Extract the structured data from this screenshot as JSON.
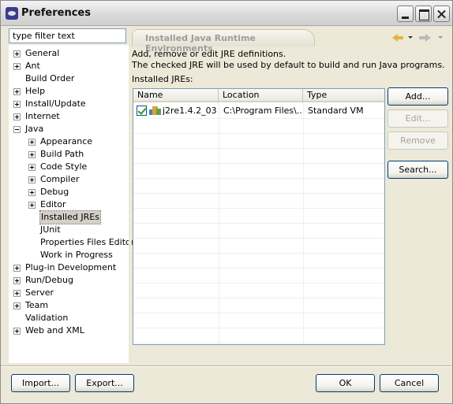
{
  "window": {
    "title": "Preferences"
  },
  "filter": {
    "placeholder": "type filter text"
  },
  "tree": [
    {
      "label": "General",
      "depth": 0,
      "expander": "plus"
    },
    {
      "label": "Ant",
      "depth": 0,
      "expander": "plus"
    },
    {
      "label": "Build Order",
      "depth": 0,
      "expander": "none"
    },
    {
      "label": "Help",
      "depth": 0,
      "expander": "plus"
    },
    {
      "label": "Install/Update",
      "depth": 0,
      "expander": "plus"
    },
    {
      "label": "Internet",
      "depth": 0,
      "expander": "plus"
    },
    {
      "label": "Java",
      "depth": 0,
      "expander": "minus"
    },
    {
      "label": "Appearance",
      "depth": 1,
      "expander": "plus"
    },
    {
      "label": "Build Path",
      "depth": 1,
      "expander": "plus"
    },
    {
      "label": "Code Style",
      "depth": 1,
      "expander": "plus"
    },
    {
      "label": "Compiler",
      "depth": 1,
      "expander": "plus"
    },
    {
      "label": "Debug",
      "depth": 1,
      "expander": "plus"
    },
    {
      "label": "Editor",
      "depth": 1,
      "expander": "plus"
    },
    {
      "label": "Installed JREs",
      "depth": 1,
      "expander": "none",
      "selected": true
    },
    {
      "label": "JUnit",
      "depth": 1,
      "expander": "none"
    },
    {
      "label": "Properties Files Editor",
      "depth": 1,
      "expander": "none"
    },
    {
      "label": "Work in Progress",
      "depth": 1,
      "expander": "none"
    },
    {
      "label": "Plug-in Development",
      "depth": 0,
      "expander": "plus"
    },
    {
      "label": "Run/Debug",
      "depth": 0,
      "expander": "plus"
    },
    {
      "label": "Server",
      "depth": 0,
      "expander": "plus"
    },
    {
      "label": "Team",
      "depth": 0,
      "expander": "plus"
    },
    {
      "label": "Validation",
      "depth": 0,
      "expander": "none"
    },
    {
      "label": "Web and XML",
      "depth": 0,
      "expander": "plus"
    }
  ],
  "page": {
    "title": "Installed Java Runtime Environments",
    "description_line1": "Add, remove or edit JRE definitions.",
    "description_line2": "The checked JRE will be used by default to build and run Java programs.",
    "installed_label": "Installed JREs:"
  },
  "table": {
    "columns": [
      "Name",
      "Location",
      "Type"
    ],
    "rows": [
      {
        "checked": true,
        "name": "j2re1.4.2_03",
        "location": "C:\\Program Files\\...",
        "type": "Standard VM"
      }
    ]
  },
  "side_buttons": {
    "add": "Add...",
    "edit": "Edit...",
    "remove": "Remove",
    "search": "Search..."
  },
  "footer": {
    "import": "Import...",
    "export": "Export...",
    "ok": "OK",
    "cancel": "Cancel"
  },
  "colors": {
    "dialog_bg": "#ECE9D8",
    "input_border": "#7f9db9",
    "button_border": "#003c74",
    "selection_bg": "#d4d0c8"
  }
}
